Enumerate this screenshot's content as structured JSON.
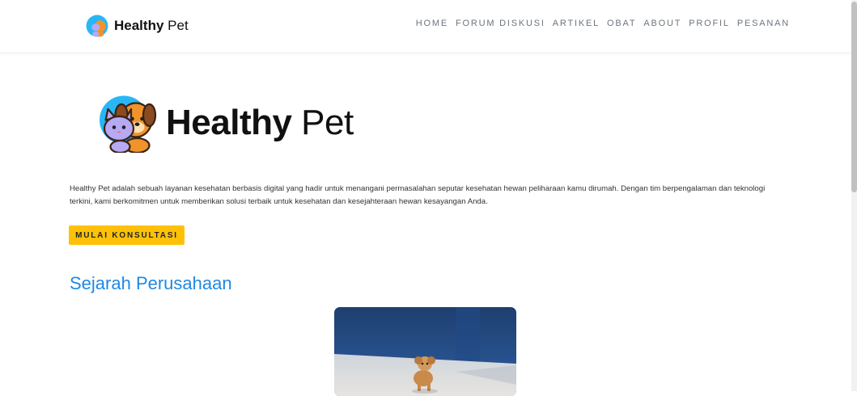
{
  "brand": {
    "bold": "Healthy",
    "light": " Pet"
  },
  "nav": [
    "HOME",
    "FORUM DISKUSI",
    "ARTIKEL",
    "OBAT",
    "ABOUT",
    "PROFIL",
    "PESANAN"
  ],
  "hero": {
    "bold": "Healthy",
    "light": " Pet"
  },
  "description": "Healthy Pet adalah sebuah layanan kesehatan berbasis digital yang hadir untuk menangani permasalahan seputar kesehatan hewan peliharaan kamu dirumah. Dengan tim berpengalaman dan teknologi terkini, kami berkomitmen untuk memberikan solusi terbaik untuk kesehatan dan kesejahteraan hewan kesayangan Anda.",
  "cta_label": "MULAI KONSULTASI",
  "section_title": "Sejarah Perusahaan",
  "colors": {
    "accent": "#ffc107",
    "title_blue": "#1e88e5",
    "logo_circle": "#29b6f6"
  },
  "icons": {
    "brand_logo": "cat-dog-logo-icon",
    "hero_logo": "cat-dog-logo-icon"
  }
}
